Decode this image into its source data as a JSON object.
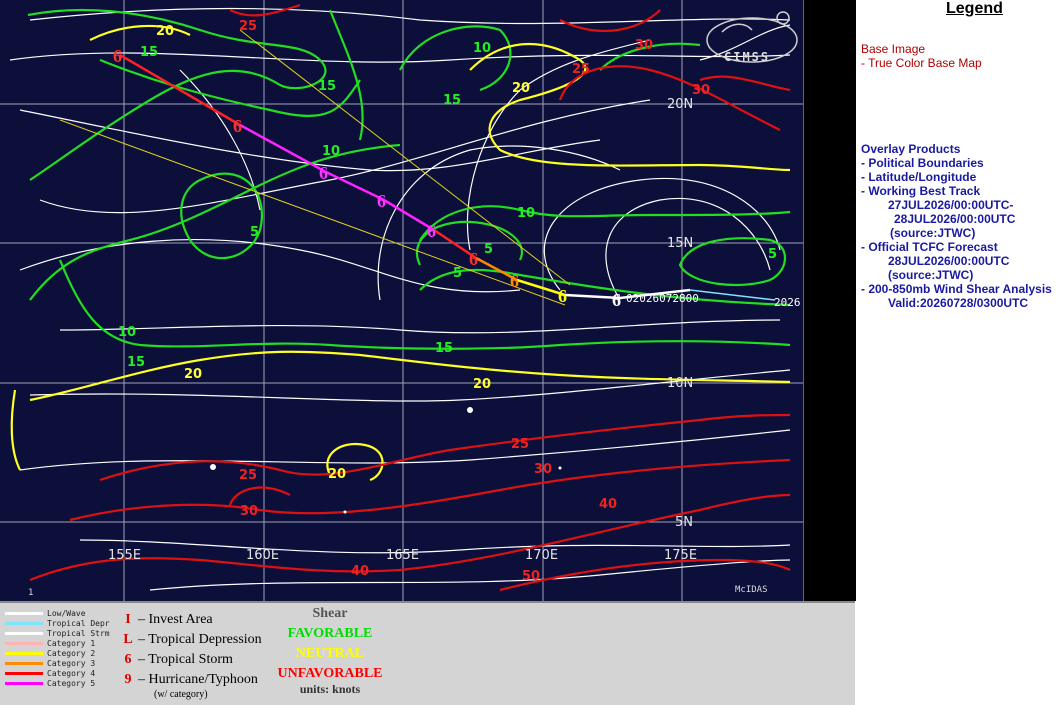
{
  "map": {
    "lat_labels": [
      "20N",
      "15N",
      "10N",
      "5N"
    ],
    "lon_labels": [
      "155E",
      "160E",
      "165E",
      "170E",
      "175E"
    ],
    "storm_id_label": "02026072800",
    "edge_label": "2026",
    "footer_left": "1",
    "footer_right": "McIDAS",
    "logo_text": "CIMSS",
    "contour_labels": {
      "green": [
        "15",
        "15",
        "15",
        "10",
        "10",
        "5",
        "5",
        "10",
        "5",
        "15",
        "10",
        "15",
        "5"
      ],
      "yellow": [
        "20",
        "20",
        "20",
        "20",
        "20"
      ],
      "red": [
        "25",
        "25",
        "30",
        "30",
        "25",
        "25",
        "30",
        "30",
        "40",
        "50",
        "40"
      ]
    }
  },
  "legend": {
    "title": "Legend",
    "base_image_head": "Base Image",
    "base_image_item": "-  True Color Base Map",
    "overlay_head": "Overlay Products",
    "overlay_items": [
      "-  Political Boundaries",
      "-  Latitude/Longitude",
      "-  Working Best Track",
      "27JUL2026/00:00UTC-",
      "28JUL2026/00:00UTC",
      "(source:JTWC)",
      "-  Official TCFC Forecast",
      "28JUL2026/00:00UTC",
      "(source:JTWC)",
      "-  200-850mb Wind Shear Analysis",
      "Valid:20260728/0300UTC"
    ]
  },
  "bottom": {
    "track_legend": [
      {
        "label": "Low/Wave",
        "color": "#ffffff"
      },
      {
        "label": "Tropical Depr",
        "color": "#7fe5ff"
      },
      {
        "label": "Tropical Strm",
        "color": "#ffffff"
      },
      {
        "label": "Category 1",
        "color": "#ffb3b3"
      },
      {
        "label": "Category 2",
        "color": "#ffff00"
      },
      {
        "label": "Category 3",
        "color": "#ff8c00"
      },
      {
        "label": "Category 4",
        "color": "#ff0000"
      },
      {
        "label": "Category 5",
        "color": "#ff00ff"
      }
    ],
    "symbols": [
      {
        "glyph": "I",
        "label": "– Invest Area"
      },
      {
        "glyph": "L",
        "label": "– Tropical Depression"
      },
      {
        "glyph": "6",
        "label": "– Tropical Storm"
      },
      {
        "glyph": "9",
        "label": "– Hurricane/Typhoon"
      }
    ],
    "symbols_note": "(w/ category)",
    "shear_title": "Shear",
    "shear_favorable": "FAVORABLE",
    "shear_neutral": "NEUTRAL",
    "shear_unfavorable": "UNFAVORABLE",
    "shear_units": "units: knots",
    "colors": {
      "favorable": "#00dd00",
      "neutral": "#ffff00",
      "unfavorable": "#ff0000"
    }
  }
}
